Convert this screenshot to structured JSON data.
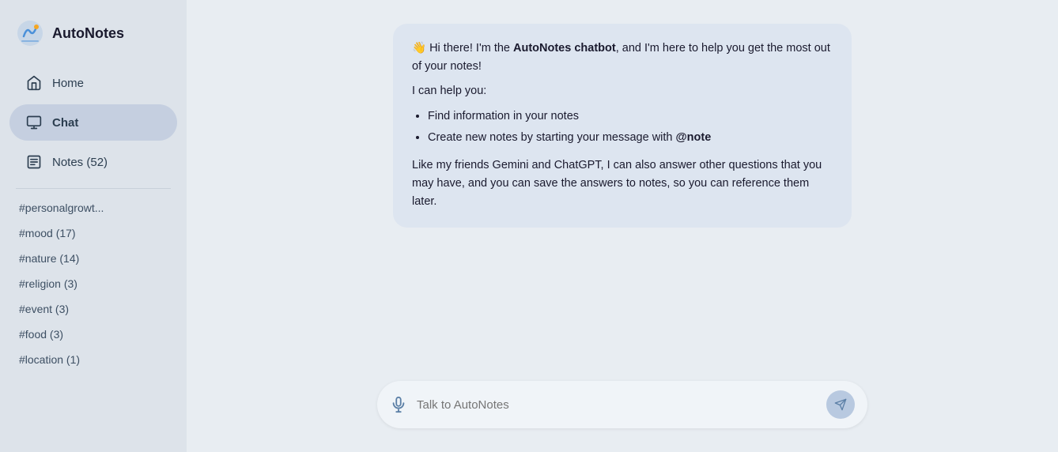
{
  "app": {
    "name": "AutoNotes"
  },
  "sidebar": {
    "nav_items": [
      {
        "id": "home",
        "label": "Home",
        "icon": "home-icon"
      },
      {
        "id": "chat",
        "label": "Chat",
        "icon": "chat-icon",
        "active": true
      },
      {
        "id": "notes",
        "label": "Notes (52)",
        "icon": "notes-icon"
      }
    ],
    "tags": [
      {
        "label": "#personalgrowt..."
      },
      {
        "label": "#mood (17)"
      },
      {
        "label": "#nature (14)"
      },
      {
        "label": "#religion (3)"
      },
      {
        "label": "#event (3)"
      },
      {
        "label": "#food (3)"
      },
      {
        "label": "#location (1)"
      }
    ]
  },
  "chat": {
    "bot_message": {
      "greeting": "👋 Hi there! I'm the ",
      "bot_name": "AutoNotes chatbot",
      "greeting_end": ", and I'm here to help you get the most out of your notes!",
      "can_help": "I can help you:",
      "bullets": [
        "Find information in your notes",
        "Create new notes by starting your message with @note"
      ],
      "footer_start": "Like my friends Gemini and ChatGPT, I can also answer other questions that you may have, and you can save the answers to notes, so you can reference them later."
    },
    "input_placeholder": "Talk to AutoNotes"
  }
}
